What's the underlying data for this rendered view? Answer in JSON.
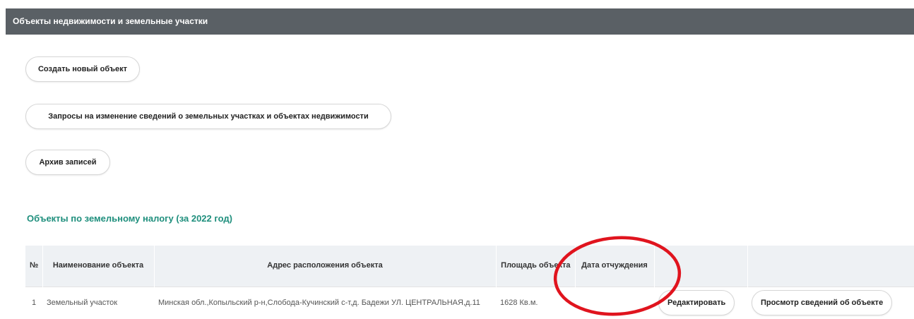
{
  "panel": {
    "title": "Объекты недвижимости и земельные участки"
  },
  "actions": {
    "create_label": "Создать новый объект",
    "requests_label": "Запросы на изменение сведений о земельных участках и объектах недвижимости",
    "archive_label": "Архив записей"
  },
  "section": {
    "title": "Объекты по земельному налогу (за 2022 год)"
  },
  "table": {
    "headers": {
      "num": "№",
      "name": "Наименование объекта",
      "address": "Адрес расположения объекта",
      "area": "Площадь объекта",
      "date": "Дата отчуждения",
      "edit": "",
      "view": ""
    },
    "rows": [
      {
        "num": "1",
        "name": "Земельный участок",
        "address": "Минская обл.,Копыльский р-н,Слобода-Кучинский с-т,д. Бадежи УЛ. ЦЕНТРАЛЬНАЯ,д.11",
        "area": "1628 Кв.м.",
        "date": "",
        "edit_label": "Редактировать",
        "view_label": "Просмотр сведений об объекте"
      }
    ]
  },
  "colors": {
    "header_bg": "#5a6065",
    "section_title": "#1f8f7d",
    "table_header_bg": "#eef1f4",
    "annotation": "#e0141e"
  },
  "annotation": {
    "shape": "ellipse",
    "target": "Дата отчуждения"
  }
}
